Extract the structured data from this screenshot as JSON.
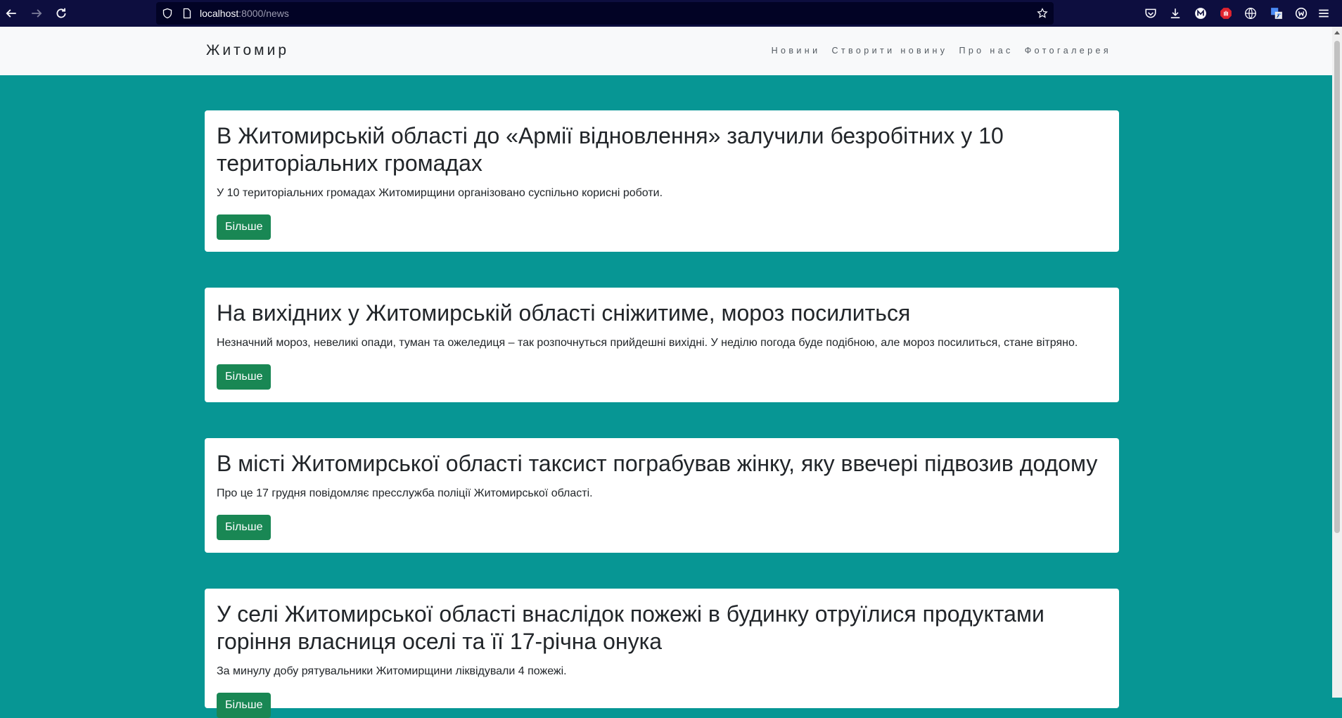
{
  "browser": {
    "url_host": "localhost",
    "url_path": ":8000/news"
  },
  "site": {
    "brand": "Житомир",
    "nav": [
      {
        "label": "Новини"
      },
      {
        "label": "Створити новину"
      },
      {
        "label": "Про нас"
      },
      {
        "label": "Фотогалерея"
      }
    ]
  },
  "news": [
    {
      "title": "В Житомирській області до «Армії відновлення» залучили безробітних у 10 територіальних громадах",
      "summary": "У 10 територіальних громадах Житомирщини організовано суспільно корисні роботи.",
      "button": "Більше"
    },
    {
      "title": "На вихідних у Житомирській області сніжитиме, мороз посилиться",
      "summary": "Незначний мороз, невеликі опади, туман та ожеледиця – так розпочнуться прийдешні вихідні. У неділю погода буде подібною, але мороз посилиться, стане вітряно.",
      "button": "Більше"
    },
    {
      "title": "В місті Житомирської області таксист пограбував жінку, яку ввечері підвозив додому",
      "summary": "Про це 17 грудня повідомляє пресслужба поліції Житомирської області.",
      "button": "Більше"
    },
    {
      "title": "У селі Житомирської області внаслідок пожежі в будинку отруїлися продуктами горіння власниця оселі та її 17-річна онука",
      "summary": "За минулу добу рятувальники Житомирщини ліквідували 4 пожежі.",
      "button": "Більше"
    }
  ],
  "colors": {
    "page_background": "#079694",
    "button": "#198754",
    "navbar": "#f8f9fa",
    "browser_chrome": "#0d0e3f"
  }
}
